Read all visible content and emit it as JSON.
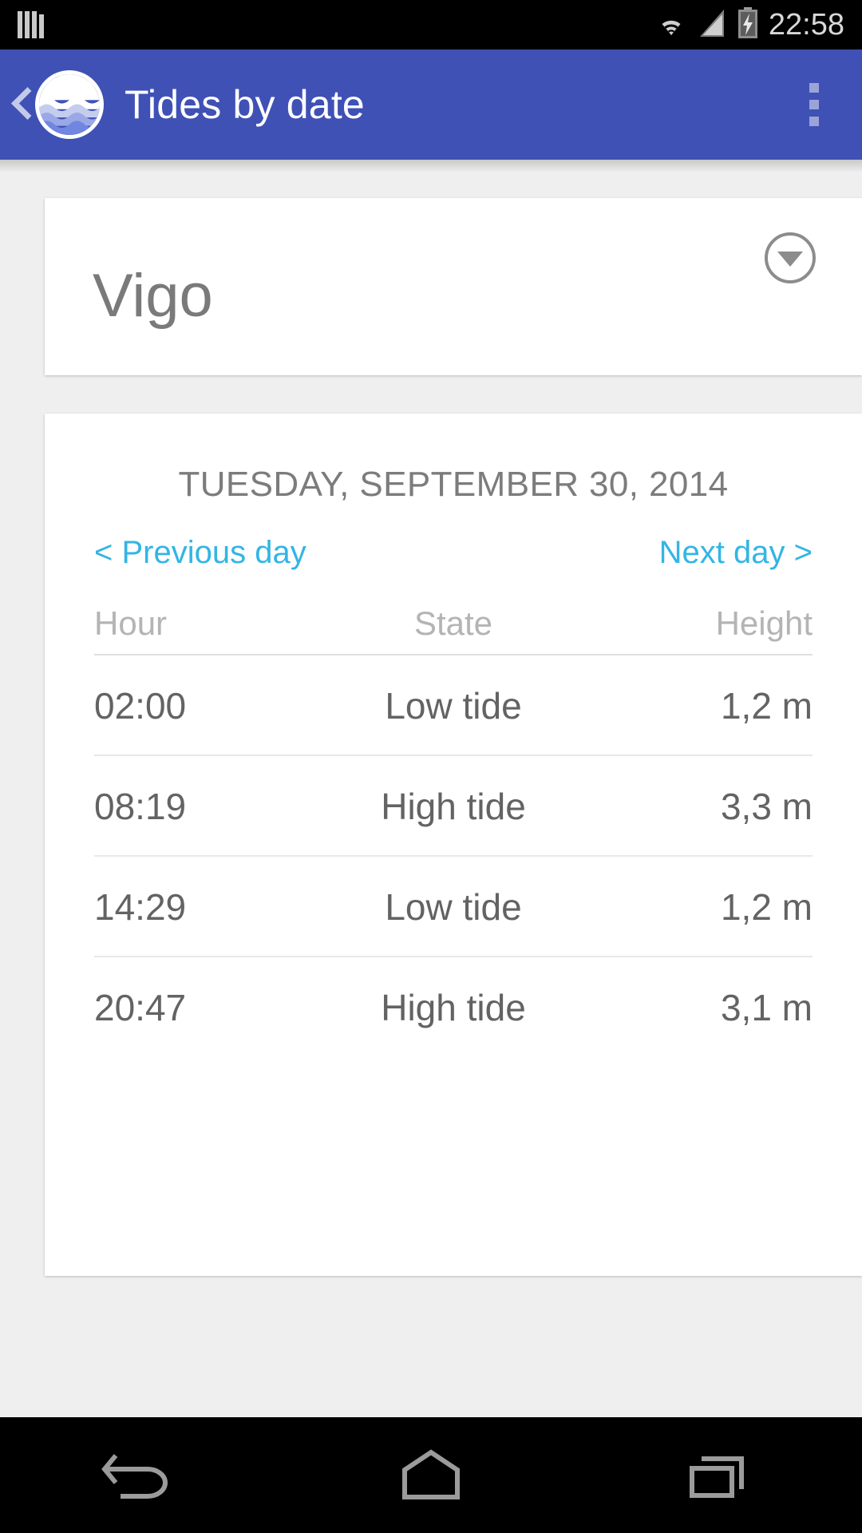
{
  "status_bar": {
    "notification_icon": "signal-bars-icon",
    "wifi_icon": "wifi-icon",
    "cell_icon": "cell-signal-icon",
    "battery_icon": "battery-charging-icon",
    "clock": "22:58"
  },
  "app_bar": {
    "back_icon": "back-chevron-icon",
    "logo_icon": "tides-waves-logo-icon",
    "title": "Tides by date",
    "overflow_icon": "overflow-menu-icon"
  },
  "location_card": {
    "name": "Vigo",
    "dropdown_icon": "chevron-down-circle-icon"
  },
  "tides_card": {
    "date": "TUESDAY, SEPTEMBER 30, 2014",
    "prev_day": "< Previous day",
    "next_day": "Next day >",
    "columns": [
      "Hour",
      "State",
      "Height"
    ],
    "rows": [
      {
        "hour": "02:00",
        "state": "Low tide",
        "height": "1,2 m"
      },
      {
        "hour": "08:19",
        "state": "High tide",
        "height": "3,3 m"
      },
      {
        "hour": "14:29",
        "state": "Low tide",
        "height": "1,2 m"
      },
      {
        "hour": "20:47",
        "state": "High tide",
        "height": "3,1 m"
      }
    ]
  },
  "nav_bar": {
    "back": "back-nav-icon",
    "home": "home-nav-icon",
    "recents": "recents-nav-icon"
  },
  "colors": {
    "app_bar": "#3f51b5",
    "accent_link": "#33b5e5",
    "page_bg": "#efefef",
    "card_bg": "#ffffff",
    "text_primary": "#636363",
    "text_muted": "#b4b4b4"
  }
}
